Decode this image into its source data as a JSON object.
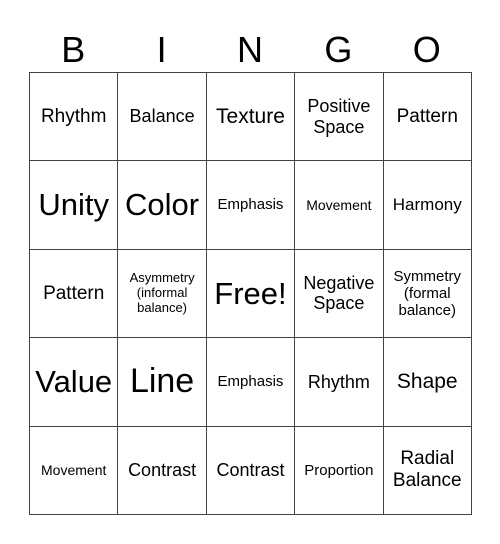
{
  "header": {
    "letters": [
      "B",
      "I",
      "N",
      "G",
      "O"
    ]
  },
  "grid": {
    "rows": [
      [
        "Rhythm",
        "Balance",
        "Texture",
        "Positive Space",
        "Pattern"
      ],
      [
        "Unity",
        "Color",
        "Emphasis",
        "Movement",
        "Harmony"
      ],
      [
        "Pattern",
        "Asymmetry (informal balance)",
        "Free!",
        "Negative Space",
        "Symmetry (formal balance)"
      ],
      [
        "Value",
        "Line",
        "Emphasis",
        "Rhythm",
        "Shape"
      ],
      [
        "Movement",
        "Contrast",
        "Contrast",
        "Proportion",
        "Radial Balance"
      ]
    ]
  }
}
